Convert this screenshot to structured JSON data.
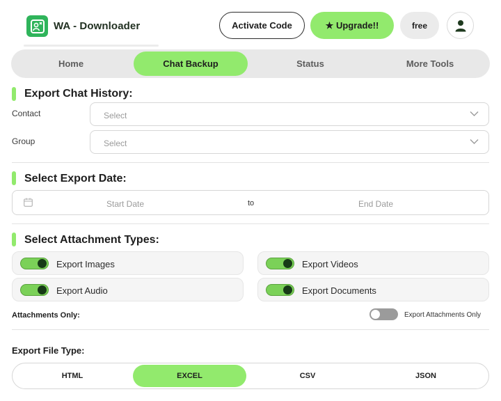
{
  "header": {
    "app_title": "WA - Downloader",
    "logo_icon": "app-logo-icon",
    "activate_label": "Activate Code",
    "upgrade_label": "★ Upgrade!!",
    "plan_label": "free",
    "user_icon": "user-icon"
  },
  "tabs": [
    {
      "label": "Home",
      "active": false
    },
    {
      "label": "Chat Backup",
      "active": true
    },
    {
      "label": "Status",
      "active": false
    },
    {
      "label": "More Tools",
      "active": false
    }
  ],
  "export_history": {
    "title": "Export Chat History:",
    "contact_label": "Contact",
    "contact_placeholder": "Select",
    "group_label": "Group",
    "group_placeholder": "Select"
  },
  "export_date": {
    "title": "Select Export Date:",
    "start_placeholder": "Start Date",
    "separator": "to",
    "end_placeholder": "End Date"
  },
  "attachments": {
    "title": "Select Attachment Types:",
    "items": [
      {
        "label": "Export Images",
        "enabled": true
      },
      {
        "label": "Export Videos",
        "enabled": true
      },
      {
        "label": "Export Audio",
        "enabled": true
      },
      {
        "label": "Export Documents",
        "enabled": true
      }
    ],
    "only_label": "Attachments Only:",
    "only_toggle_label": "Export Attachments Only",
    "only_enabled": false
  },
  "file_type": {
    "label": "Export File Type:",
    "options": [
      "HTML",
      "EXCEL",
      "CSV",
      "JSON"
    ],
    "selected": "EXCEL"
  },
  "colors": {
    "accent": "#92ea6d",
    "logo": "#2fb45b",
    "toggle_on": "#7bd158",
    "toggle_off": "#9b9b9b"
  }
}
